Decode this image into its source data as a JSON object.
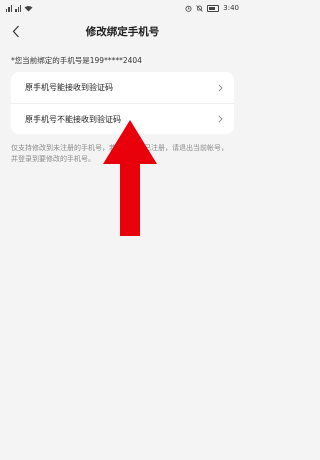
{
  "status_bar": {
    "time": "3:40",
    "icons": [
      "signal-icon",
      "wifi-icon",
      "alarm-icon",
      "mute-icon",
      "battery-icon"
    ]
  },
  "header": {
    "title": "修改绑定手机号",
    "back_icon": "chevron-left-icon"
  },
  "hint": "*您当前绑定的手机号是199*****2404",
  "options": [
    {
      "label": "原手机号能接收到验证码"
    },
    {
      "label": "原手机号不能接收到验证码"
    }
  ],
  "note": "仅支持修改到未注册的手机号，若新手机号已注册，请退出当前帐号，并登录到要修改的手机号。",
  "colors": {
    "background": "#f4f4f4",
    "card": "#ffffff",
    "arrow": "#e8000b"
  }
}
